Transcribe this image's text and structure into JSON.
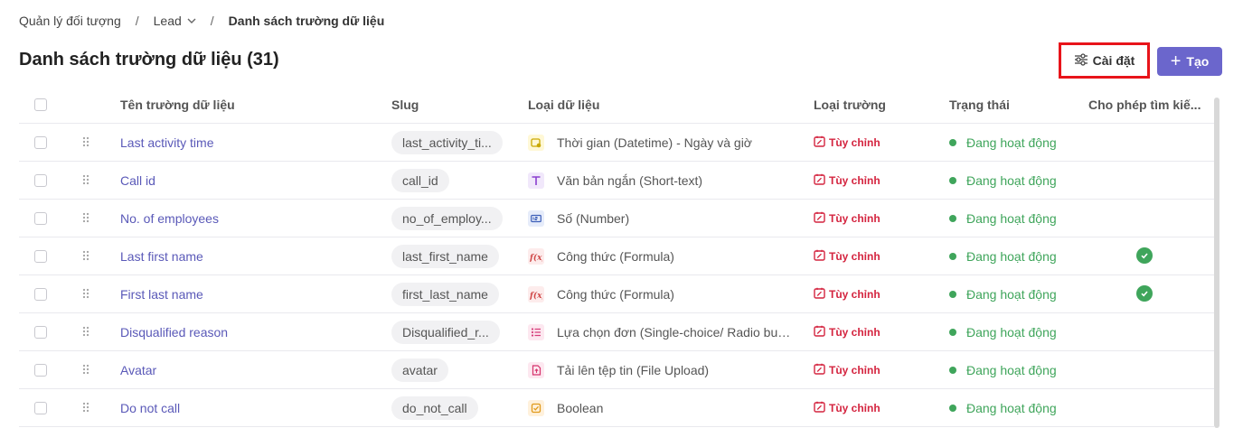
{
  "breadcrumb": {
    "root": "Quản lý đối tượng",
    "object": "Lead",
    "current": "Danh sách trường dữ liệu"
  },
  "page": {
    "title": "Danh sách trường dữ liệu (31)"
  },
  "toolbar": {
    "settings_label": "Cài đặt",
    "create_label": "Tạo"
  },
  "table": {
    "columns": {
      "name": "Tên trường dữ liệu",
      "slug": "Slug",
      "data_type": "Loại dữ liệu",
      "field_type": "Loại trường",
      "status": "Trạng thái",
      "searchable": "Cho phép tìm kiế..."
    },
    "rows": [
      {
        "name": "Last activity time",
        "slug": "last_activity_ti...",
        "data_type": "Thời gian (Datetime) - Ngày và giờ",
        "icon": "datetime-icon",
        "field_type": "Tùy chỉnh",
        "status": "Đang hoạt động",
        "searchable": false
      },
      {
        "name": "Call id",
        "slug": "call_id",
        "data_type": "Văn bản ngắn (Short-text)",
        "icon": "text-icon",
        "field_type": "Tùy chỉnh",
        "status": "Đang hoạt động",
        "searchable": false
      },
      {
        "name": "No. of employees",
        "slug": "no_of_employ...",
        "data_type": "Số (Number)",
        "icon": "number-icon",
        "field_type": "Tùy chỉnh",
        "status": "Đang hoạt động",
        "searchable": false
      },
      {
        "name": "Last first name",
        "slug": "last_first_name",
        "data_type": "Công thức (Formula)",
        "icon": "formula-icon",
        "field_type": "Tùy chỉnh",
        "status": "Đang hoạt động",
        "searchable": true
      },
      {
        "name": "First last name",
        "slug": "first_last_name",
        "data_type": "Công thức (Formula)",
        "icon": "formula-icon",
        "field_type": "Tùy chỉnh",
        "status": "Đang hoạt động",
        "searchable": true
      },
      {
        "name": "Disqualified reason",
        "slug": "Disqualified_r...",
        "data_type": "Lựa chọn đơn (Single-choice/ Radio butt...",
        "icon": "list-icon",
        "field_type": "Tùy chỉnh",
        "status": "Đang hoạt động",
        "searchable": false
      },
      {
        "name": "Avatar",
        "slug": "avatar",
        "data_type": "Tải lên tệp tin (File Upload)",
        "icon": "file-upload-icon",
        "field_type": "Tùy chỉnh",
        "status": "Đang hoạt động",
        "searchable": false
      },
      {
        "name": "Do not call",
        "slug": "do_not_call",
        "data_type": "Boolean",
        "icon": "boolean-icon",
        "field_type": "Tùy chỉnh",
        "status": "Đang hoạt động",
        "searchable": false
      }
    ]
  },
  "colors": {
    "accent": "#6b66cc",
    "link": "#5a59b8",
    "custom_field": "#d4243f",
    "active_status": "#3fa55b",
    "highlight_border": "#e8141a"
  }
}
